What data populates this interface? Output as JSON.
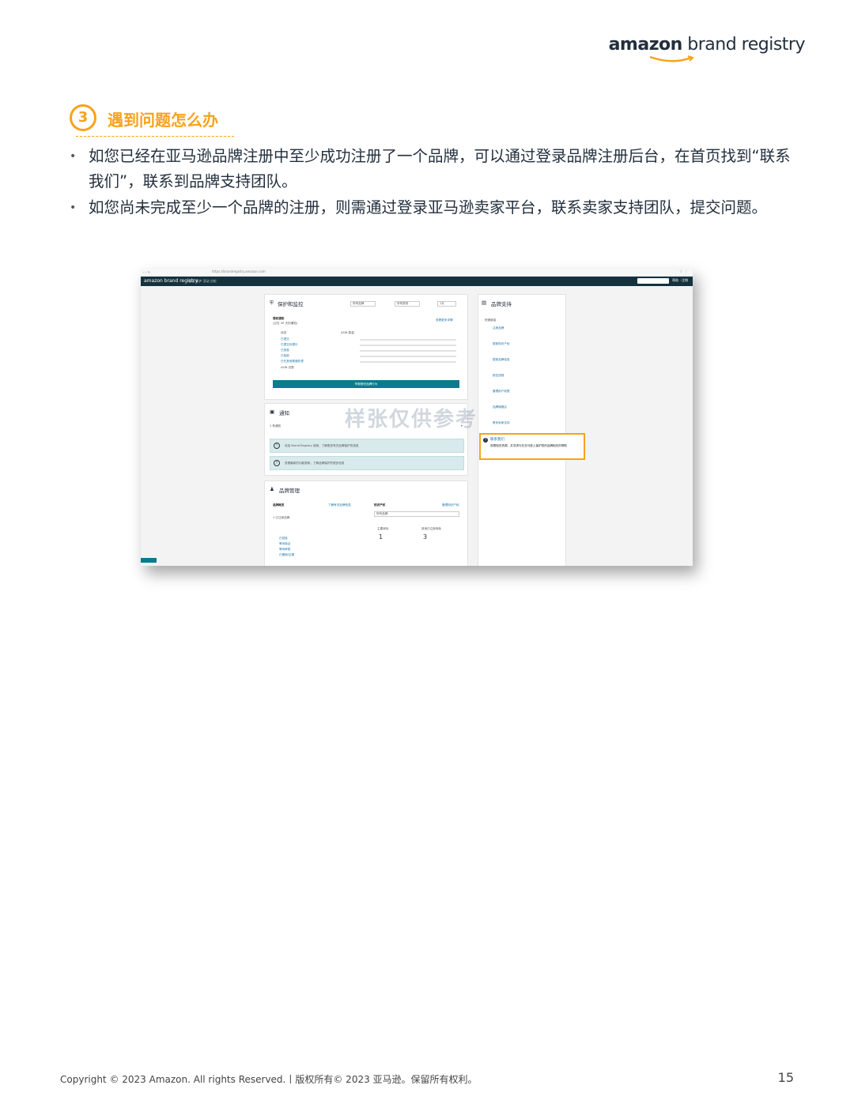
{
  "header": {
    "logo_amazon": "amazon",
    "logo_rest": " brand registry",
    "logo_arrow_color": "#f7a21b"
  },
  "section": {
    "number": "3",
    "title": "遇到问题怎么办",
    "accent_color": "#f7a21b"
  },
  "bullets": [
    "如您已经在亚马逊品牌注册中至少成功注册了一个品牌，可以通过登录品牌注册后台，在首页找到“联系我们”，联系到品牌支持团队。",
    "如您尚未完成至少一个品牌的注册，则需通过登录亚马逊卖家平台，联系卖家支持团队，提交问题。"
  ],
  "screenshot": {
    "browser_url": "https://brandregistry.amazon.com",
    "brand": "amazon brand registry",
    "nav_items": "管理   保护   活动   分析",
    "nav_right": "帮助 · 注销",
    "protect_title": "保护和监控",
    "protect_select1": "所有品牌",
    "protect_select2": "所有类别",
    "protect_select3": "1天",
    "rights_title": "侵权通知",
    "rights_sub": "(过去 30 天的通知)",
    "rights_link": "查看更多详情",
    "rights_col1": "状态",
    "rights_col2": "ASIN 数量",
    "rights_rows": [
      "已提交",
      "已提交处理中",
      "已批准",
      "已拒绝",
      "已在其他渠道处理"
    ],
    "rights_total_label": "ASIN 总数",
    "rights_button": "举报侵犯品牌行为",
    "notify_title": "通知",
    "notify_count": "2 条通知",
    "alert1": "欢迎 Brand Registry 使用，了解更多有关品牌保护的信息",
    "alert2": "查看最新的功能更新，了解品牌保护的更多信息",
    "mgmt_title": "品牌管理",
    "mgmt_overview": "品牌概览",
    "mgmt_link": "了解有关品牌信息",
    "mgmt_count_label": "1 已注册品牌",
    "mgmt_rows": [
      "已批准",
      "等待验证",
      "等待审核",
      "已撤销/过期"
    ],
    "ip_title": "知识产权",
    "ip_link": "管理知识产权",
    "ip_select": "所有品牌",
    "ip_col1": "主要商标",
    "ip_col2": "其他已注册商标",
    "ip_num1": "1",
    "ip_num2": "3",
    "support_title": "品牌支持",
    "support_sub": "快速链接",
    "support_items": [
      "注册品牌",
      "更新知识产权",
      "更新品牌信息",
      "报告违规",
      "管理用户权限",
      "品牌旗舰店",
      "联系卖家支持"
    ],
    "contact_title": "联系我们",
    "contact_desc": "查看相关资源，并寻求与在亚马逊上保护您的品牌相关的帮助",
    "watermark": "样张仅供参考"
  },
  "footer": {
    "copyright": "Copyright © 2023 Amazon. All rights Reserved.丨版权所有© 2023 亚马逊。保留所有权利。",
    "page": "15"
  }
}
